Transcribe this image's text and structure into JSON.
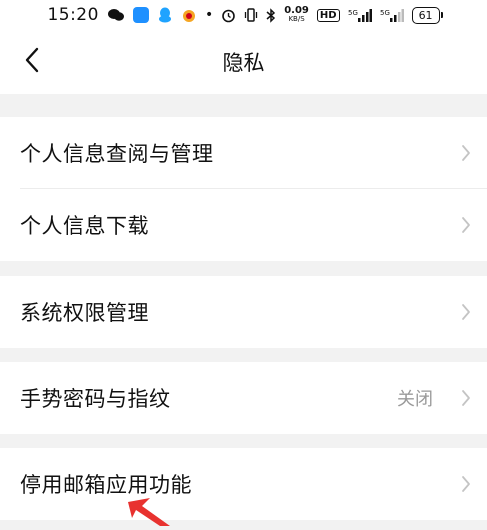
{
  "status_bar": {
    "time": "15:20",
    "net_speed_value": "0.09",
    "net_speed_unit": "KB/S",
    "hd_badge": "HD",
    "signal_1": "⁵ᴳ",
    "signal_2": "⁵ᴳ",
    "battery": "61"
  },
  "header": {
    "title": "隐私"
  },
  "settings": {
    "group1": [
      {
        "label": "个人信息查阅与管理",
        "value": ""
      },
      {
        "label": "个人信息下载",
        "value": ""
      }
    ],
    "group2": [
      {
        "label": "系统权限管理",
        "value": ""
      }
    ],
    "group3": [
      {
        "label": "手势密码与指纹",
        "value": "关闭"
      }
    ],
    "group4": [
      {
        "label": "停用邮箱应用功能",
        "value": ""
      }
    ]
  },
  "colors": {
    "background": "#f2f2f2",
    "surface": "#ffffff",
    "text": "#111111",
    "secondary_text": "#9a9a9a",
    "chevron": "#c4c4c4",
    "annotation": "#e8322f"
  },
  "icons": {
    "back": "chevron-left-icon",
    "row_chevron": "chevron-right-icon"
  }
}
